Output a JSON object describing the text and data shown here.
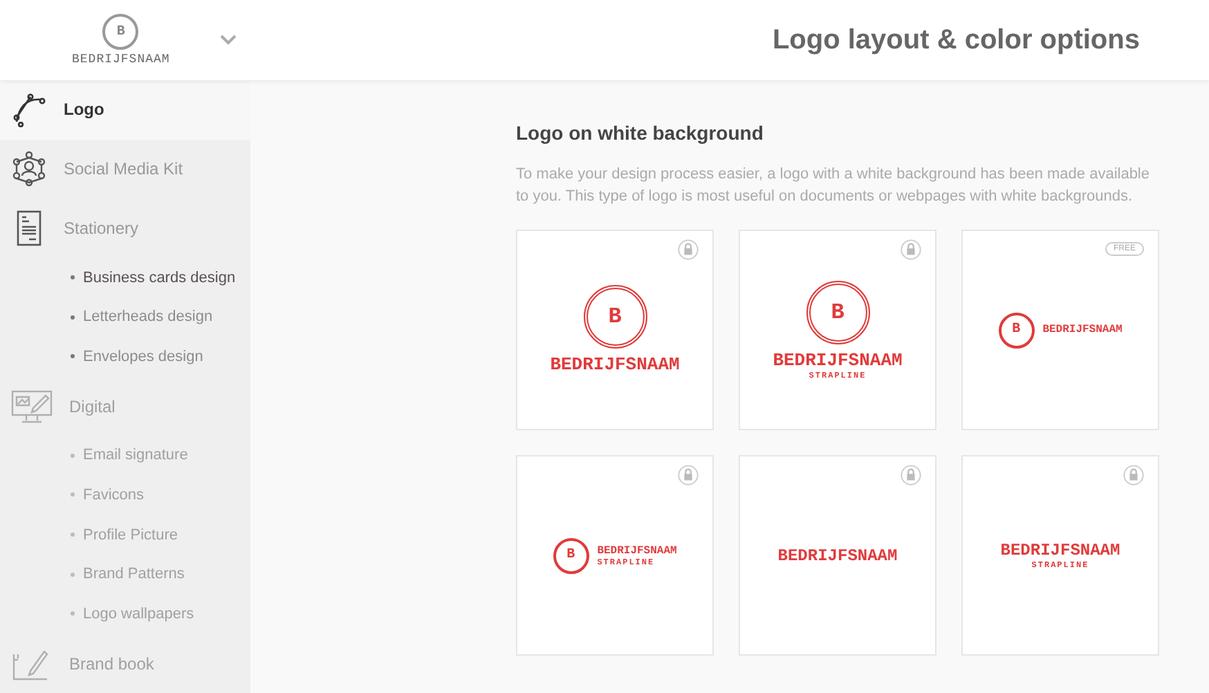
{
  "header": {
    "brand": {
      "letter": "B",
      "name": "BEDRIJFSNAAM"
    },
    "title": "Logo layout & color options"
  },
  "sidebar": {
    "items": [
      {
        "label": "Logo",
        "selected": true,
        "disabled": false
      },
      {
        "label": "Social Media Kit",
        "selected": false,
        "disabled": false
      },
      {
        "label": "Stationery",
        "selected": false,
        "disabled": false,
        "children": [
          {
            "label": "Business cards design",
            "selected": true,
            "disabled": false
          },
          {
            "label": "Letterheads design",
            "selected": false,
            "disabled": false
          },
          {
            "label": "Envelopes design",
            "selected": false,
            "disabled": false
          }
        ]
      },
      {
        "label": "Digital",
        "selected": false,
        "disabled": true,
        "children": [
          {
            "label": "Email signature",
            "selected": false,
            "disabled": true
          },
          {
            "label": "Favicons",
            "selected": false,
            "disabled": true
          },
          {
            "label": "Profile Picture",
            "selected": false,
            "disabled": true
          },
          {
            "label": "Brand Patterns",
            "selected": false,
            "disabled": true
          },
          {
            "label": "Logo wallpapers",
            "selected": false,
            "disabled": true
          }
        ]
      },
      {
        "label": "Brand book",
        "selected": false,
        "disabled": true
      }
    ]
  },
  "section": {
    "heading": "Logo on white background",
    "description": "To make your design process easier, a logo with a white background has been made available to you. This type of logo is most useful on documents or webpages with white backgrounds.",
    "cards": [
      {
        "kind": "stacked",
        "letter": "B",
        "name": "BEDRIJFSNAAM",
        "badge": {
          "kind": "lock"
        }
      },
      {
        "kind": "stacked",
        "letter": "B",
        "name": "BEDRIJFSNAAM",
        "strapline": "STRAPLINE",
        "badge": {
          "kind": "lock"
        }
      },
      {
        "kind": "horizontal",
        "letter": "B",
        "name": "BEDRIJFSNAAM",
        "badge": {
          "kind": "free",
          "label": "FREE"
        }
      },
      {
        "kind": "horizontal",
        "letter": "B",
        "name": "BEDRIJFSNAAM",
        "strapline": "STRAPLINE",
        "badge": {
          "kind": "lock"
        }
      },
      {
        "kind": "text",
        "name": "BEDRIJFSNAAM",
        "badge": {
          "kind": "lock"
        }
      },
      {
        "kind": "text",
        "name": "BEDRIJFSNAAM",
        "strapline": "STRAPLINE",
        "badge": {
          "kind": "lock"
        }
      }
    ]
  }
}
